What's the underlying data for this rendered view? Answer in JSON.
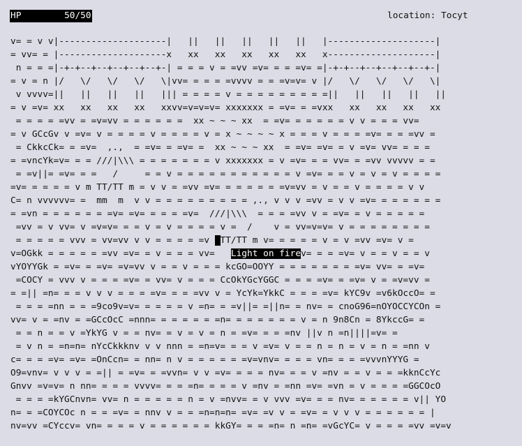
{
  "hud": {
    "hp_label": "HP",
    "hp_value": "50/50",
    "location": "location: Tocyt"
  },
  "map": {
    "rows": [
      "v= = v v|--------------------|   ||   ||   ||   ||   ||   |--------------------|",
      "= vv= = |--------------------x   xx   xx   xx   xx   xx   x--------------------|",
      " n = = =|-+-+--+--+--+--+--+-| = = = v = =vv =v= = = =v= =|-+-+--+--+--+--+--+-|",
      "= v = n |/   \\/   \\/   \\/   \\|vv= = = = =vvvv = = =v=v= v |/   \\/   \\/   \\/   \\|",
      " v vvvv=||   ||   ||   ||   ||| = = = = v = = = = = = = = =||   ||   ||   ||   ||",
      "= v =v= xx   xx   xx   xx   xxvv=v=v=v= xxxxxxx = =v= = =vxx   xx   xx   xx   xx",
      " = = = = =vv = =v=vv = = = = = =  xx ~ ~ ~ xx  = =v= = = = = = v v = = = vv=",
      "= v GCcGv v =v= v = = = = v = = = = v = x ~ ~ ~ ~ x = = = v = = = =v= = = =vv =",
      " = CkkcCk= = =v=  ,.,  = =v= = =v= =  xx ~ ~ ~ xx  = =v= =v= = v =v= vv= = = =",
      "= =vncYk=v= = = ///|\\\\\\ = = = = = = = v xxxxxxx = v =v= = = vv= = =vv vvvvv = =",
      " = =v||= =v= = =   /     = = v = = = = = = = = = = = v =v= = = v = v = v = = = =",
      "=v= = = = = v m TT/TT m = v v = =vv =v= = = = = = =v=vv = v = = v = = = = v v",
      "C= n vvvvvv= =  mm  m  v v = = = = = = = = = ,., v v v =vv = v v =v= = = = = = =",
      "= =vn = = = = = = =v= =v= = = = =v=  ///|\\\\\\  = = = =vv v = =v= = v = = = = =",
      " =vv = v vv= v =v=v= = = v = v = = = = v =  /    v = vv=v=v= v = = = = = = = =",
      " = = = = = vvv = vv=vv v v = = = = =v mTT/TT m v= = = = = v = v =vv =v= v =",
      "v=OGkk = = = = = =vv =v= = v = = = vv=   Light on firev= = = =v= v = = v = = v",
      "vYOYYGk = =v= = =v= =v=vv v = = v = = = kcGO=OOYY = = = = = = = =v= vv= = =v=",
      " =COCY = vvv v = = = =v= = vv= v = = = CcOkYGcYGGC = = = =v= = =v= v = =v=vv =",
      "= =|| =n= = = v v v = = = =v= = = =vv v = YcYk=YkkC = = = =v= kYC9v =v6kOccO= =",
      " = = = =nn = = =9co9v=v= = = = = v =n= = =v||= =||n= = nv= = cnoG96=nOYOCCYCOn =",
      "vv= v = =nv = =GCcOcC =nnn= = = = = = =n= = = = = = = v = n 9n8Cn = 8YkccG= =",
      " = = n = = v =YkYG v = = nv= = v = v = n = =v= = = =nv ||v n =n||||=v= =",
      " = v n = =n=n= nYcCkkknv v v nnn = =n=v= = = v =v= v = = n = n = v = n = =nn v",
      "c= = = =v= =v= =OnCcn= = nn= n v = = = = = =v=vnv= = = = vn= = = =vvvnYYYG =",
      "O9=vnv= v v v = =|| = =v= = =vvn= v v =v= = = = nv= = = v =nv = = v = = =kknCcYc",
      "Gnvv =v=v= n nn= = = = vvvv= = = =n= = = = v =nv = =nn =v= =vn = v = = = =GGCOcO",
      " = = = =kYGCnvn= vv= n = = = = = n = v =nvv= = v vvv =v= = = nv= = = = = = v|| YO",
      "n= = =COYCOc n = = =v= = nnv v = = =n=n=n= =v= =v v = =v= = v v v = = = = = = |",
      "nv=vv =CYccv= vn= = = = v = = = = = = kkGY= = = =n= n =n= =vGcYC= v = = = =vv =v=v"
    ],
    "player_row": 15,
    "player_marker": "m",
    "message_row": 16,
    "message": "Light on fire"
  }
}
